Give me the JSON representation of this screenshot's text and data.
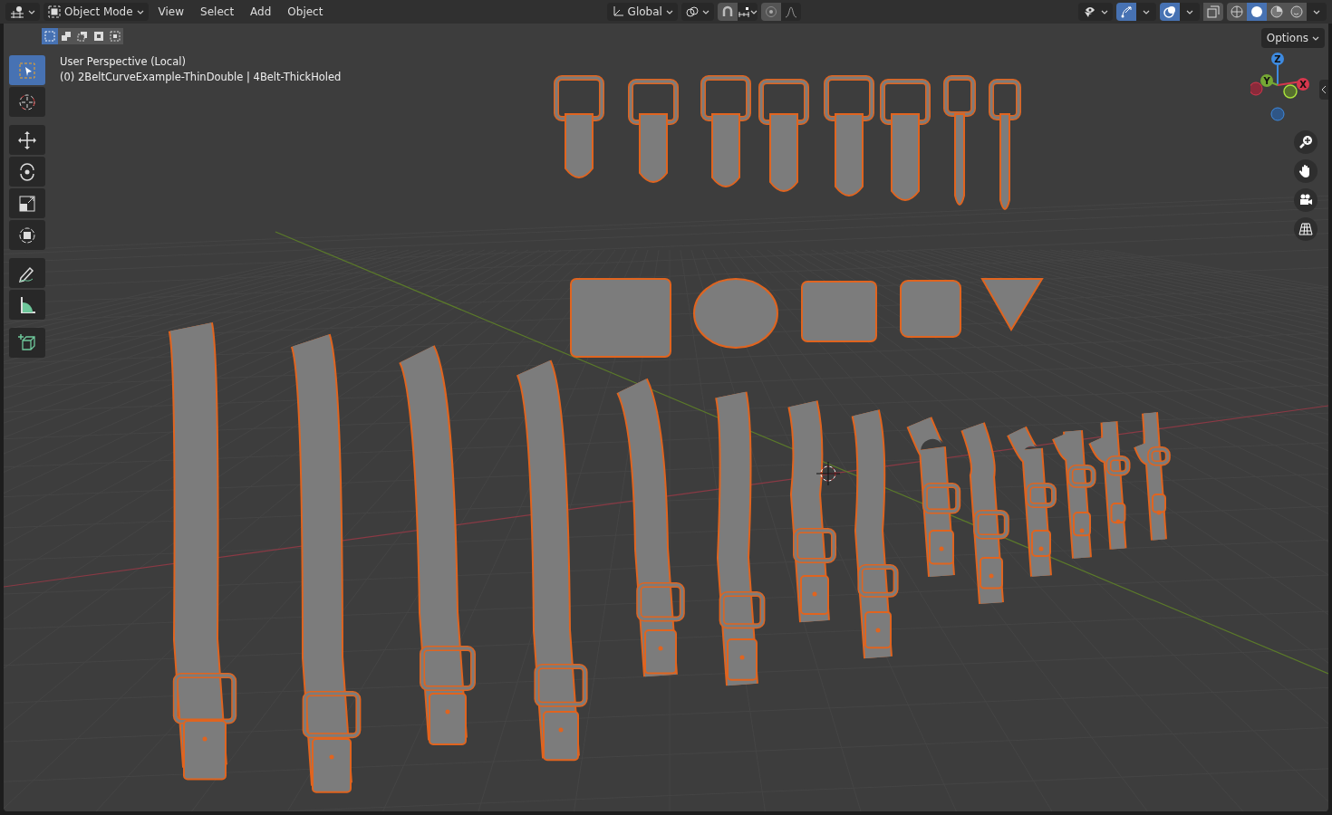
{
  "header": {
    "mode": "Object Mode",
    "menus": [
      "View",
      "Select",
      "Add",
      "Object"
    ],
    "transform_orientation": "Global",
    "snap": {
      "on": false
    },
    "proportional_editing": {
      "on": false
    },
    "gizmos": {
      "on": true
    },
    "overlays": {
      "on": true
    },
    "xray": {
      "on": false
    },
    "shading_modes": [
      {
        "selected": false
      },
      {
        "selected": true
      },
      {
        "selected": false
      },
      {
        "selected": false
      }
    ]
  },
  "select_modes": [
    {
      "selected": true
    },
    {
      "selected": false
    },
    {
      "selected": false
    },
    {
      "selected": false
    },
    {
      "selected": false
    }
  ],
  "viewport": {
    "perspective_label": "User Perspective (Local)",
    "object_label": "(0) 2BeltCurveExample-ThinDouble | 4Belt-ThickHoled",
    "options": "Options"
  },
  "tools": [
    {
      "selected": true
    },
    {
      "selected": false
    },
    {
      "selected": false
    },
    {
      "selected": false
    },
    {
      "selected": false
    },
    {
      "selected": false
    },
    {
      "selected": false
    },
    {
      "selected": false
    },
    {
      "selected": false
    }
  ],
  "gizmo_axes": [
    "X",
    "Y",
    "Z"
  ]
}
